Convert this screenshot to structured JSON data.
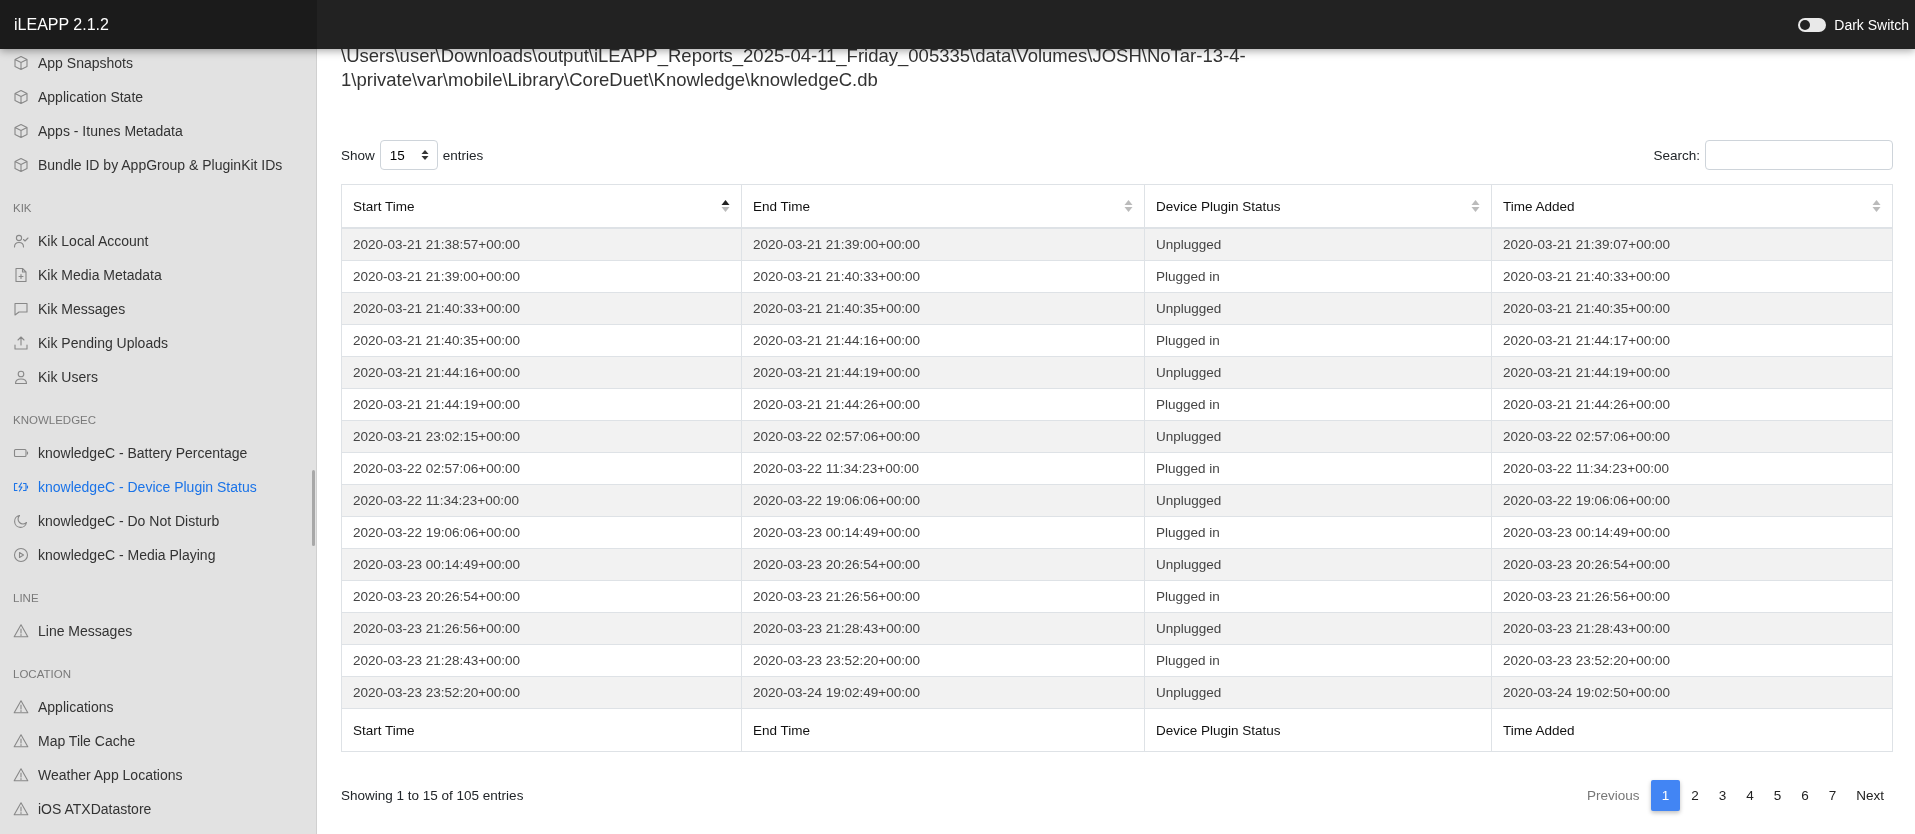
{
  "app_bar": {
    "title": "iLEAPP 2.1.2",
    "switch": {
      "label": "Dark Switch",
      "on": false
    }
  },
  "sidebar": {
    "sections": [
      {
        "items": [
          {
            "label": "App Snapshots",
            "kind": "cube",
            "selected": false
          },
          {
            "label": "Application State",
            "kind": "cube",
            "selected": false
          },
          {
            "label": "Apps - Itunes Metadata",
            "kind": "cube",
            "selected": false
          },
          {
            "label": "Bundle ID by AppGroup & PluginKit IDs",
            "kind": "cube",
            "selected": false
          }
        ]
      },
      {
        "title": "KIK",
        "items": [
          {
            "label": "Kik Local Account",
            "kind": "user-check",
            "selected": false
          },
          {
            "label": "Kik Media Metadata",
            "kind": "file-plus",
            "selected": false
          },
          {
            "label": "Kik Messages",
            "kind": "message",
            "selected": false
          },
          {
            "label": "Kik Pending Uploads",
            "kind": "upload",
            "selected": false
          },
          {
            "label": "Kik Users",
            "kind": "user",
            "selected": false
          }
        ]
      },
      {
        "title": "KNOWLEDGEC",
        "items": [
          {
            "label": "knowledgeC - Battery Percentage",
            "kind": "battery",
            "selected": false
          },
          {
            "label": "knowledgeC - Device Plugin Status",
            "kind": "battery-charging",
            "selected": true
          },
          {
            "label": "knowledgeC - Do Not Disturb",
            "kind": "moon",
            "selected": false
          },
          {
            "label": "knowledgeC - Media Playing",
            "kind": "play",
            "selected": false
          }
        ]
      },
      {
        "title": "LINE",
        "items": [
          {
            "label": "Line Messages",
            "kind": "warning",
            "selected": false
          }
        ]
      },
      {
        "title": "LOCATION",
        "items": [
          {
            "label": "Applications",
            "kind": "warning",
            "selected": false
          },
          {
            "label": "Map Tile Cache",
            "kind": "warning",
            "selected": false
          },
          {
            "label": "Weather App Locations",
            "kind": "warning",
            "selected": false
          },
          {
            "label": "iOS ATXDatastore",
            "kind": "warning",
            "selected": false
          }
        ]
      }
    ]
  },
  "source_path": [
    "\\Users\\user\\Downloads\\output\\iLEAPP_Reports_2025-04-11_Friday_005335\\data\\Volumes\\JOSH\\NoTar-13-4-",
    "1\\private\\var\\mobile\\Library\\CoreDuet\\Knowledge\\knowledgeC.db"
  ],
  "length_control": {
    "before": "Show",
    "value": "15",
    "after": "entries"
  },
  "search": {
    "label": "Search:"
  },
  "table": {
    "columns": [
      {
        "label": "Start Time",
        "sorted": true
      },
      {
        "label": "End Time",
        "sorted": false
      },
      {
        "label": "Device Plugin Status",
        "sorted": false
      },
      {
        "label": "Time Added",
        "sorted": false
      }
    ],
    "rows": [
      [
        "2020-03-21 21:38:57+00:00",
        "2020-03-21 21:39:00+00:00",
        "Unplugged",
        "2020-03-21 21:39:07+00:00"
      ],
      [
        "2020-03-21 21:39:00+00:00",
        "2020-03-21 21:40:33+00:00",
        "Plugged in",
        "2020-03-21 21:40:33+00:00"
      ],
      [
        "2020-03-21 21:40:33+00:00",
        "2020-03-21 21:40:35+00:00",
        "Unplugged",
        "2020-03-21 21:40:35+00:00"
      ],
      [
        "2020-03-21 21:40:35+00:00",
        "2020-03-21 21:44:16+00:00",
        "Plugged in",
        "2020-03-21 21:44:17+00:00"
      ],
      [
        "2020-03-21 21:44:16+00:00",
        "2020-03-21 21:44:19+00:00",
        "Unplugged",
        "2020-03-21 21:44:19+00:00"
      ],
      [
        "2020-03-21 21:44:19+00:00",
        "2020-03-21 21:44:26+00:00",
        "Plugged in",
        "2020-03-21 21:44:26+00:00"
      ],
      [
        "2020-03-21 23:02:15+00:00",
        "2020-03-22 02:57:06+00:00",
        "Unplugged",
        "2020-03-22 02:57:06+00:00"
      ],
      [
        "2020-03-22 02:57:06+00:00",
        "2020-03-22 11:34:23+00:00",
        "Plugged in",
        "2020-03-22 11:34:23+00:00"
      ],
      [
        "2020-03-22 11:34:23+00:00",
        "2020-03-22 19:06:06+00:00",
        "Unplugged",
        "2020-03-22 19:06:06+00:00"
      ],
      [
        "2020-03-22 19:06:06+00:00",
        "2020-03-23 00:14:49+00:00",
        "Plugged in",
        "2020-03-23 00:14:49+00:00"
      ],
      [
        "2020-03-23 00:14:49+00:00",
        "2020-03-23 20:26:54+00:00",
        "Unplugged",
        "2020-03-23 20:26:54+00:00"
      ],
      [
        "2020-03-23 20:26:54+00:00",
        "2020-03-23 21:26:56+00:00",
        "Plugged in",
        "2020-03-23 21:26:56+00:00"
      ],
      [
        "2020-03-23 21:26:56+00:00",
        "2020-03-23 21:28:43+00:00",
        "Unplugged",
        "2020-03-23 21:28:43+00:00"
      ],
      [
        "2020-03-23 21:28:43+00:00",
        "2020-03-23 23:52:20+00:00",
        "Plugged in",
        "2020-03-23 23:52:20+00:00"
      ],
      [
        "2020-03-23 23:52:20+00:00",
        "2020-03-24 19:02:49+00:00",
        "Unplugged",
        "2020-03-24 19:02:50+00:00"
      ]
    ],
    "footer": [
      "Start Time",
      "End Time",
      "Device Plugin Status",
      "Time Added"
    ]
  },
  "info": "Showing 1 to 15 of 105 entries",
  "pagination": {
    "previous": {
      "label": "Previous",
      "disabled": true
    },
    "pages": [
      {
        "label": "1",
        "selected": true
      },
      {
        "label": "2",
        "selected": false
      },
      {
        "label": "3",
        "selected": false
      },
      {
        "label": "4",
        "selected": false
      },
      {
        "label": "5",
        "selected": false
      },
      {
        "label": "6",
        "selected": false
      },
      {
        "label": "7",
        "selected": false
      }
    ],
    "next": {
      "label": "Next",
      "disabled": false
    }
  }
}
